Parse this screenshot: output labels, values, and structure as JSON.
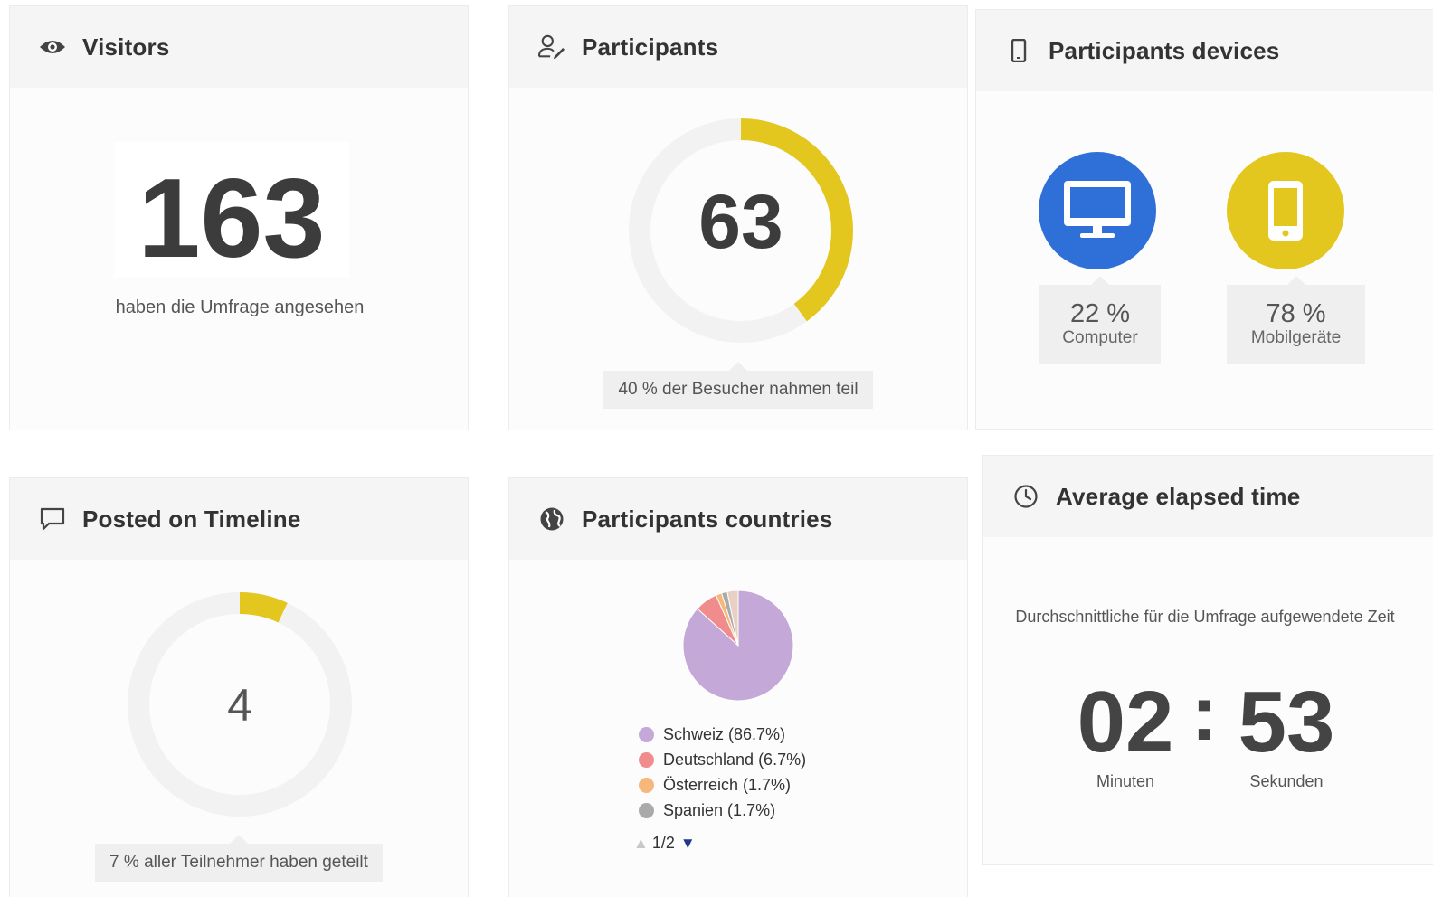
{
  "visitors": {
    "title": "Visitors",
    "icon": "eye-icon",
    "count": "163",
    "caption": "haben die Umfrage angesehen"
  },
  "participants": {
    "title": "Participants",
    "icon": "user-edit-icon",
    "count": "63",
    "progress_fraction": 0.4,
    "tooltip": "40 % der Besucher nahmen teil",
    "accent": "#e3c71f"
  },
  "devices": {
    "title": "Participants devices",
    "icon": "mobile-phone-icon",
    "items": [
      {
        "icon": "desktop-monitor-icon",
        "percent": "22 %",
        "label": "Computer",
        "color": "#2f6fd8"
      },
      {
        "icon": "smartphone-icon",
        "percent": "78 %",
        "label": "Mobilgeräte",
        "color": "#e3c71f"
      }
    ]
  },
  "timeline": {
    "title": "Posted on Timeline",
    "icon": "comment-icon",
    "count": "4",
    "progress_fraction": 0.07,
    "tooltip": "7 % aller Teilnehmer haben geteilt"
  },
  "countries": {
    "title": "Participants countries",
    "icon": "globe-icon",
    "chart_data": {
      "type": "pie",
      "categories": [
        "Schweiz",
        "Deutschland",
        "Österreich",
        "Spanien"
      ],
      "values": [
        86.7,
        6.7,
        1.7,
        1.7
      ],
      "colors": [
        "#c4a8d8",
        "#f08c8c",
        "#f5b87a",
        "#aaaaaa"
      ]
    },
    "legend": [
      {
        "label": "Schweiz (86.7%)",
        "color": "#c4a8d8"
      },
      {
        "label": "Deutschland (6.7%)",
        "color": "#f08c8c"
      },
      {
        "label": "Österreich (1.7%)",
        "color": "#f5b87a"
      },
      {
        "label": "Spanien (1.7%)",
        "color": "#aaaaaa"
      }
    ],
    "pager": "1/2"
  },
  "elapsed": {
    "title": "Average elapsed time",
    "icon": "clock-icon",
    "description": "Durchschnittliche für die Umfrage aufgewendete Zeit",
    "minutes": "02",
    "separator": ":",
    "seconds": "53",
    "minutes_label": "Minuten",
    "seconds_label": "Sekunden"
  }
}
